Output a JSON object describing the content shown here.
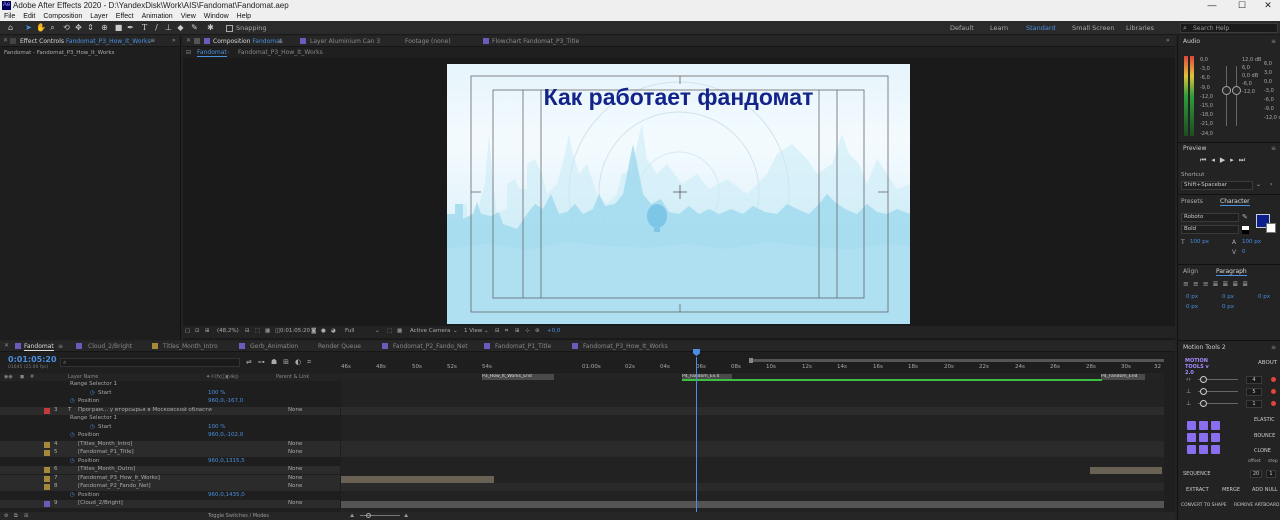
{
  "titlebar": {
    "app_icon": "Ae",
    "title": "Adobe After Effects 2020 - D:\\YandexDisk\\Work\\AIS\\Fandomat\\Fandomat.aep",
    "minimize": "—",
    "maximize": "☐",
    "close": "✕"
  },
  "menu": [
    "File",
    "Edit",
    "Composition",
    "Layer",
    "Effect",
    "Animation",
    "View",
    "Window",
    "Help"
  ],
  "toolbar": {
    "snapping_label": "Snapping",
    "workspaces": [
      "Default",
      "Learn",
      "Standard",
      "Small Screen",
      "Libraries"
    ],
    "search_placeholder": "Search Help"
  },
  "left_panel": {
    "tab_label": "Effect Controls",
    "tab_target": "Fandomat_P3_How_It_Works",
    "breadcrumb": "Fandomat - Fandomat_P3_How_It_Works"
  },
  "comp_panel": {
    "tabs": [
      {
        "prefix": "Composition",
        "name": "Fandomat"
      },
      {
        "prefix": "Layer",
        "name": "Aluminium Can 3"
      },
      {
        "prefix": "Footage",
        "name": "(none)"
      },
      {
        "prefix": "Flowchart",
        "name": "Fandomat_P3_Title"
      }
    ],
    "subtabs": [
      "Fandomat",
      "Fandomat_P3_How_It_Works"
    ],
    "viewer_title": "Как работает фандомат",
    "footer": {
      "zoom": "(48,2%)",
      "timecode": "0:01:05:20",
      "resolution": "Full",
      "camera": "Active Camera",
      "views": "1 View",
      "exposure": "+0,0"
    }
  },
  "right_panel": {
    "audio_label": "Audio",
    "audio_left": [
      "0,0",
      "-3,0",
      "-6,0",
      "-9,0",
      "-12,0",
      "-15,0",
      "-18,0",
      "-21,0",
      "-24,0"
    ],
    "audio_right": [
      "12,0 dB",
      "6,0",
      "0,0 dB",
      "-6,0",
      "-12,0"
    ],
    "audio_right2": [
      "6,0",
      "3,0",
      "0,0",
      "-3,0",
      "-6,0",
      "-9,0",
      "-12,0 dB"
    ],
    "preview_label": "Preview",
    "shortcut_label": "Shortcut",
    "shortcut_value": "Shift+Spacebar",
    "presets_label": "Presets",
    "character_label": "Character",
    "font_family": "Roboto",
    "font_style": "Bold",
    "font_size": "100 px",
    "leading": "100 px",
    "tracking": "0",
    "align_label": "Align",
    "paragraph_label": "Paragraph",
    "indent_values": [
      "0 px",
      "0 px",
      "0 px",
      "0 px",
      "0 px"
    ],
    "motion_tools_label": "Motion Tools 2",
    "motion_tools_brand": "MOTION TOOLS v 2.0",
    "about_label": "ABOUT",
    "slider_values": [
      "4",
      "5",
      "1"
    ],
    "elastic_label": "ELASTIC",
    "bounce_label": "BOUNCE",
    "clone_label": "CLONE",
    "offset_label": "offset",
    "step_label": "step",
    "offset_value": "20",
    "step_value": "1",
    "sequence_label": "SEQUENCE",
    "extract_label": "EXTRACT",
    "merge_label": "MERGE",
    "add_null_label": "ADD NULL",
    "convert_label": "CONVERT TO SHAPE",
    "remove_artboard_label": "REMOVE ARTBOARD",
    "text_color": "#0b1e8c"
  },
  "timeline": {
    "tabs": [
      "Fandomat",
      "Cloud_2/Bright",
      "Titles_Month_Intro",
      "Gerb_Animation",
      "Render Queue",
      "Fandomat_P2_Fando_Net",
      "Fandomat_P1_Title",
      "Fandomat_P3_How_It_Works"
    ],
    "timecode": "0:01:05:20",
    "frames": "01645 (25.00 fps)",
    "col_layer_name": "Layer Name",
    "col_parent": "Parent & Link",
    "ruler": [
      "46s",
      "48s",
      "50s",
      "52s",
      "54s",
      "01:00s",
      "02s",
      "04s",
      "06s",
      "08s",
      "10s",
      "12s",
      "14s",
      "16s",
      "18s",
      "20s",
      "22s",
      "24s",
      "26s",
      "28s",
      "30s",
      "32"
    ],
    "marker_labels": [
      "P3_How_It_Works_End",
      "P4_Fandom_Ev.4",
      "P4_Fandom_End"
    ],
    "toggle_label": "Toggle Switches / Modes",
    "rows": [
      {
        "num": "",
        "name": "Range Selector 1",
        "value": "",
        "parent": ""
      },
      {
        "num": "",
        "name": "Start",
        "value": "100 %",
        "parent": ""
      },
      {
        "num": "",
        "name": "Position",
        "value": "960,0,-167,0",
        "parent": ""
      },
      {
        "num": "3",
        "name": "Програм... у вторсырья в Московской области",
        "value": "",
        "parent": "None"
      },
      {
        "num": "",
        "name": "Range Selector 1",
        "value": "",
        "parent": ""
      },
      {
        "num": "",
        "name": "Start",
        "value": "100 %",
        "parent": ""
      },
      {
        "num": "",
        "name": "Position",
        "value": "960,0,-102,0",
        "parent": ""
      },
      {
        "num": "4",
        "name": "[Titles_Month_Intro]",
        "value": "",
        "parent": "None"
      },
      {
        "num": "5",
        "name": "[Fandomat_P1_Title]",
        "value": "",
        "parent": "None"
      },
      {
        "num": "",
        "name": "Position",
        "value": "960,0,1315,5",
        "parent": ""
      },
      {
        "num": "6",
        "name": "[Titles_Month_Outro]",
        "value": "",
        "parent": "None"
      },
      {
        "num": "7",
        "name": "[Fandomat_P3_How_It_Works]",
        "value": "",
        "parent": "None"
      },
      {
        "num": "8",
        "name": "[Fandomat_P2_Fando_Net]",
        "value": "",
        "parent": "None"
      },
      {
        "num": "",
        "name": "Position",
        "value": "960,0,1435,0",
        "parent": ""
      },
      {
        "num": "9",
        "name": "[Cloud_2/Bright]",
        "value": "",
        "parent": "None"
      }
    ]
  },
  "colors": {
    "accent": "#4a90e2",
    "titlebar": "#efefef",
    "panel_bg": "#1e1e1e",
    "viewer_text": "#12238a"
  }
}
